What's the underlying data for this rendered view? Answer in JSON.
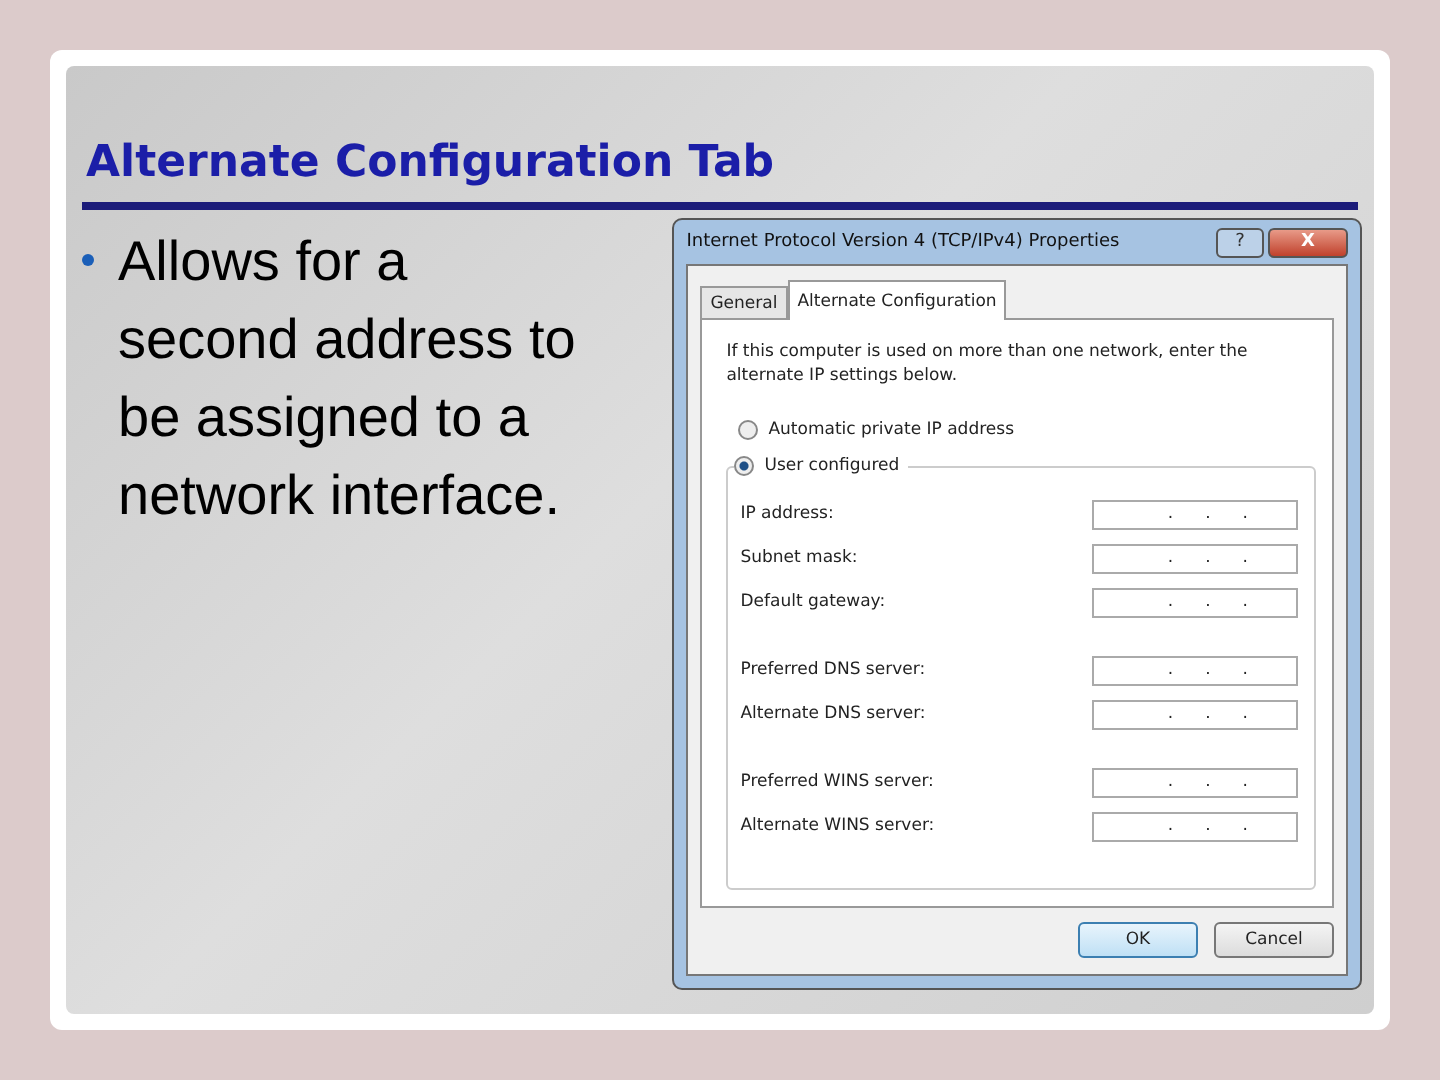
{
  "slide": {
    "title": "Alternate Configuration Tab",
    "bullets": [
      "Allows for a second address to be assigned to a network interface."
    ]
  },
  "dialog": {
    "title": "Internet Protocol Version 4 (TCP/IPv4) Properties",
    "help": "?",
    "close": "X",
    "tabs": [
      {
        "label": "General",
        "selected": false
      },
      {
        "label": "Alternate Configuration",
        "selected": true
      }
    ],
    "description": "If this computer is used on more than one network, enter the alternate IP settings below.",
    "options": [
      {
        "label": "Automatic private IP address",
        "selected": false
      },
      {
        "label": "User configured",
        "selected": true
      }
    ],
    "field_groups": [
      [
        {
          "label": "IP address:",
          "dots": [
            ".",
            ".",
            "."
          ]
        },
        {
          "label": "Subnet mask:",
          "dots": [
            ".",
            ".",
            "."
          ]
        },
        {
          "label": "Default gateway:",
          "dots": [
            ".",
            ".",
            "."
          ]
        }
      ],
      [
        {
          "label": "Preferred DNS server:",
          "dots": [
            ".",
            ".",
            "."
          ]
        },
        {
          "label": "Alternate DNS server:",
          "dots": [
            ".",
            ".",
            "."
          ]
        }
      ],
      [
        {
          "label": "Preferred WINS server:",
          "dots": [
            ".",
            ".",
            "."
          ]
        },
        {
          "label": "Alternate WINS server:",
          "dots": [
            ".",
            ".",
            "."
          ]
        }
      ]
    ],
    "buttons": [
      {
        "label": "OK",
        "default": true
      },
      {
        "label": "Cancel",
        "default": false
      }
    ]
  }
}
